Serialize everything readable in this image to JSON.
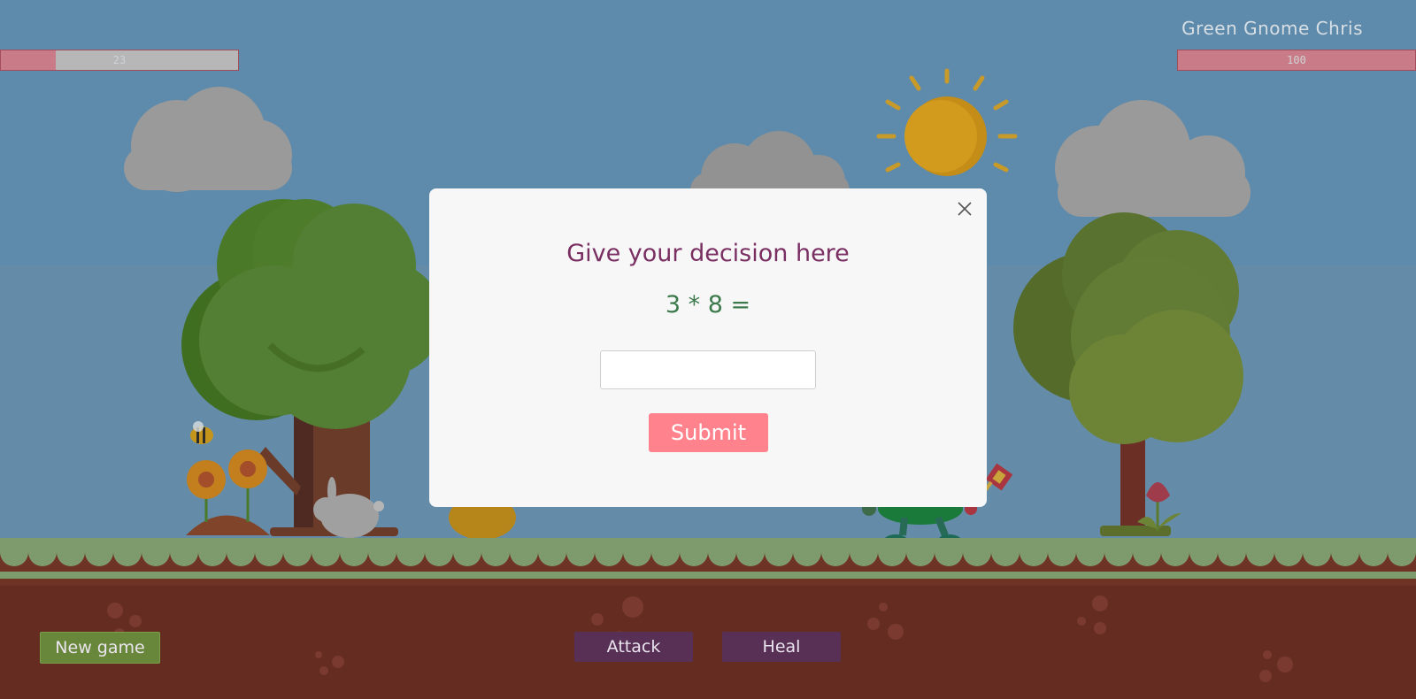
{
  "player": {
    "name": "",
    "hp": "23",
    "hp_fraction": 0.23
  },
  "enemy": {
    "name": "Green Gnome Chris",
    "hp": "100",
    "hp_fraction": 1.0
  },
  "modal": {
    "title": "Give your decision here",
    "question": "3 * 8 =",
    "answer_value": "",
    "submit_label": "Submit"
  },
  "controls": {
    "new_game_label": "New game",
    "attack_label": "Attack",
    "heal_label": "Heal"
  },
  "colors": {
    "sky": "#5e8aab",
    "grass": "#7e9b6d",
    "soil": "#652d22",
    "submit": "#ff828c",
    "action_button": "#582f55",
    "new_game_button": "#69873b"
  }
}
